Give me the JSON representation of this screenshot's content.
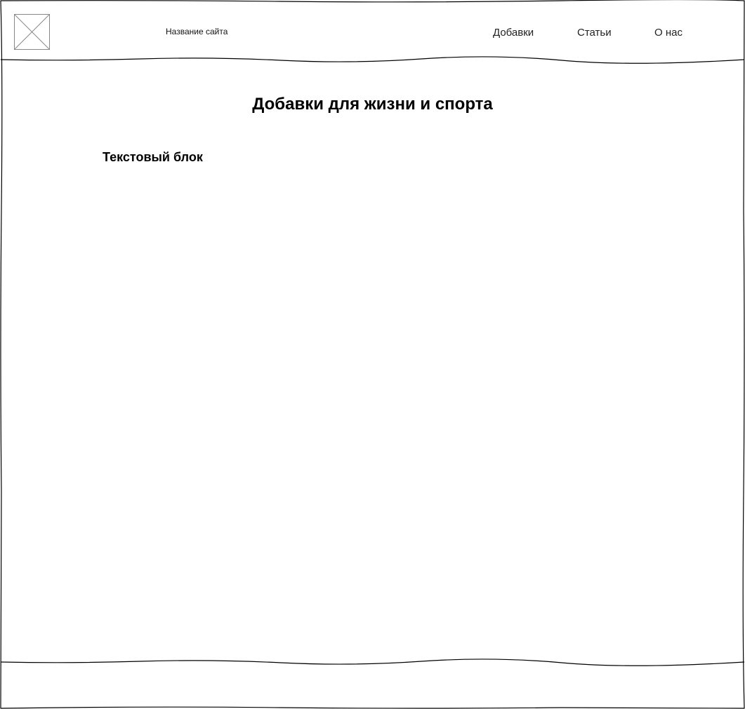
{
  "header": {
    "site_name": "Название сайта",
    "logo_icon": "image-placeholder-icon",
    "nav": [
      {
        "label": "Добавки"
      },
      {
        "label": "Статьи"
      },
      {
        "label": "О нас"
      }
    ]
  },
  "main": {
    "title": "Добавки для жизни и спорта",
    "text_block_title": "Текстовый блок"
  },
  "footer": {},
  "colors": {
    "line": "#000000",
    "placeholder_stroke": "#888888",
    "background": "#ffffff"
  }
}
